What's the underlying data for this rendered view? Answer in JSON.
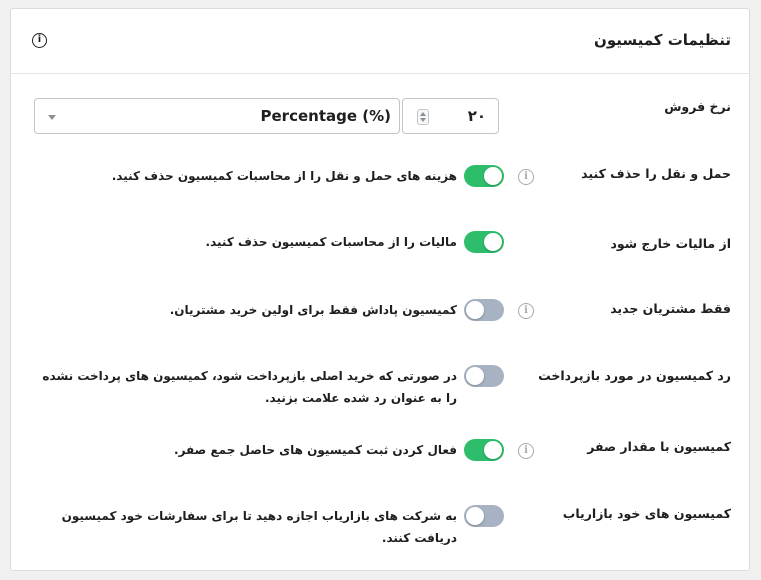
{
  "header": {
    "title": "تنظیمات کمیسیون",
    "help_icon": "info-circle-icon"
  },
  "commission_rate": {
    "label": "نرخ فروش",
    "value": "۲۰",
    "type_selected": "Percentage (%)"
  },
  "settings": [
    {
      "label": "حمل و نقل را حذف کنید",
      "description": "هزینه های حمل و نقل را از محاسبات کمیسیون حذف کنید.",
      "enabled": true,
      "info_icon": true
    },
    {
      "label": "از مالیات خارج شود",
      "description": "مالیات را از محاسبات کمیسیون حذف کنید.",
      "enabled": true,
      "info_icon": false
    },
    {
      "label": "فقط مشتریان جدید",
      "description": "کمیسیون پاداش فقط برای اولین خرید مشتریان.",
      "enabled": false,
      "info_icon": true
    },
    {
      "label": "رد کمیسیون در مورد بازپرداخت",
      "description": "در صورتی که خرید اصلی بازپرداخت شود، کمیسیون های پرداخت نشده را به عنوان رد شده علامت بزنید.",
      "enabled": false,
      "info_icon": false
    },
    {
      "label": "کمیسیون با مقدار صفر",
      "description": "فعال کردن ثبت کمیسیون های حاصل جمع صفر.",
      "enabled": true,
      "info_icon": true
    },
    {
      "label": "کمیسیون های خود بازاریاب",
      "description": "به شرکت های بازاریاب اجازه دهید تا برای سفارشات خود کمیسیون دریافت کنند.",
      "enabled": false,
      "info_icon": false
    }
  ],
  "colors": {
    "toggle_on": "#2ebd6b",
    "toggle_off": "#a7b3c2"
  }
}
